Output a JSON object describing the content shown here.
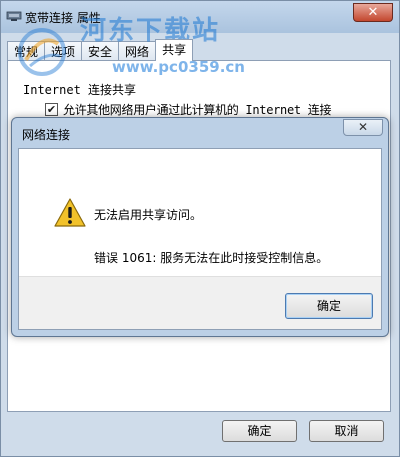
{
  "props_window": {
    "title": "宽带连接 属性",
    "close_label": "✕",
    "tabs": [
      {
        "label": "常规",
        "active": false
      },
      {
        "label": "选项",
        "active": false
      },
      {
        "label": "安全",
        "active": false
      },
      {
        "label": "网络",
        "active": false
      },
      {
        "label": "共享",
        "active": true
      }
    ],
    "sharing": {
      "group_label": "Internet 连接共享",
      "allow_label": "允许其他网络用户通过此计算机的 Internet 连接",
      "allow_checked": true
    },
    "ok_label": "确定",
    "cancel_label": "取消"
  },
  "watermark": {
    "site_name": "河东下载站",
    "url": "www.pc0359.cn"
  },
  "dialog": {
    "title": "网络连接",
    "close_label": "✕",
    "message": "无法启用共享访问。",
    "error": "错误 1061: 服务无法在此时接受控制信息。",
    "ok_label": "确定"
  },
  "colors": {
    "titlebar": "#aac3de",
    "close_red": "#c3472e",
    "dialog_frame": "#bcd0e6",
    "warning_yellow": "#f2c22a",
    "watermark_blue": "#1e78d2"
  },
  "icons": {
    "props_title": "network-connection-icon",
    "dialog_warning": "warning-icon",
    "check": "checkmark-icon"
  }
}
